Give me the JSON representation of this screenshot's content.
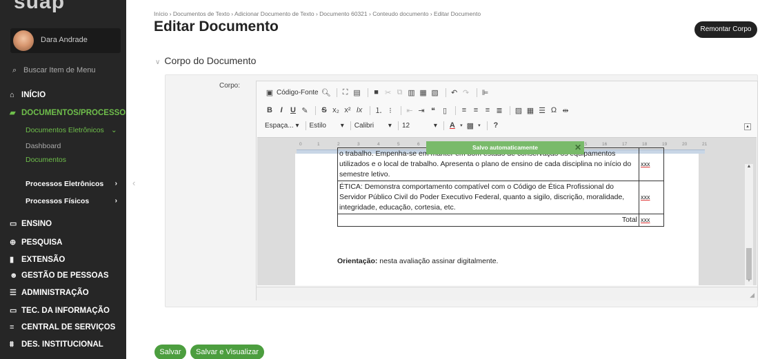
{
  "sidebar": {
    "logo": "suap",
    "user_name": "Dara Andrade",
    "search_placeholder": "Buscar Item de Menu",
    "menu": [
      {
        "label": "INÍCIO",
        "icon": "home-icon"
      },
      {
        "label": "DOCUMENTOS/PROCESSOS",
        "icon": "documents-icon"
      },
      {
        "label": "ENSINO",
        "icon": "teaching-icon"
      },
      {
        "label": "PESQUISA",
        "icon": "research-icon"
      },
      {
        "label": "EXTENSÃO",
        "icon": "extension-icon"
      },
      {
        "label": "GESTÃO DE PESSOAS",
        "icon": "people-icon"
      },
      {
        "label": "ADMINISTRAÇÃO",
        "icon": "admin-icon"
      },
      {
        "label": "TEC. DA INFORMAÇÃO",
        "icon": "it-icon"
      },
      {
        "label": "CENTRAL DE SERVIÇOS",
        "icon": "services-icon"
      },
      {
        "label": "DES. INSTITUCIONAL",
        "icon": "institutional-icon"
      }
    ],
    "submenu": {
      "electronic_docs": "Documentos Eletrônicos",
      "dashboard": "Dashboard",
      "documents": "Documentos",
      "electronic_processes": "Processos Eletrônicos",
      "physical_processes": "Processos Físicos"
    }
  },
  "header": {
    "breadcrumb": "Início › Documentos de Texto › Adicionar Documento de Texto › Documento 60321 › Conteudo documento › Editar Documento",
    "title": "Editar Documento",
    "remount_label": "Remontar Corpo"
  },
  "section": {
    "title": "Corpo do Documento",
    "field_label": "Corpo:"
  },
  "toolbar": {
    "source_label": "Código-Fonte",
    "style_combo": "Espaça...",
    "format_combo": "Estilo",
    "font_combo": "Calibri",
    "size_combo": "12",
    "help": "?"
  },
  "ruler": {
    "ticks": [
      "0",
      "1",
      "2",
      "3",
      "4",
      "5",
      "6",
      "15",
      "16",
      "17",
      "18",
      "19",
      "20",
      "21"
    ]
  },
  "toast": {
    "message": "Salvo automaticamente",
    "close": "✕"
  },
  "document": {
    "rows": [
      {
        "text": "o trabalho. Empenha-se em manter em bom estado de conservação os equipamentos utilizados e o local de trabalho. Apresenta o plano de ensino de cada disciplina no início do semestre letivo.",
        "value": "xxx"
      },
      {
        "text": "ÉTICA: Demonstra comportamento compatível com o Código de Ética Profissional do Servidor Público Civil do Poder Executivo Federal, quanto a sigilo, discrição, moralidade, integridade, educação, cortesia, etc.",
        "value": "xxx"
      }
    ],
    "total_label": "Total",
    "total_value": "xxx",
    "orientation_bold": "Orientação:",
    "orientation_text": " nesta avaliação assinar digitalmente."
  },
  "footer": {
    "save_label": "Salvar",
    "save_view_label": "Salvar e Visualizar"
  },
  "colors": {
    "sidebar_bg": "#262626",
    "accent_green": "#6fbf4b",
    "button_green": "#4c9e3f",
    "toast_green": "#79ba6a"
  }
}
